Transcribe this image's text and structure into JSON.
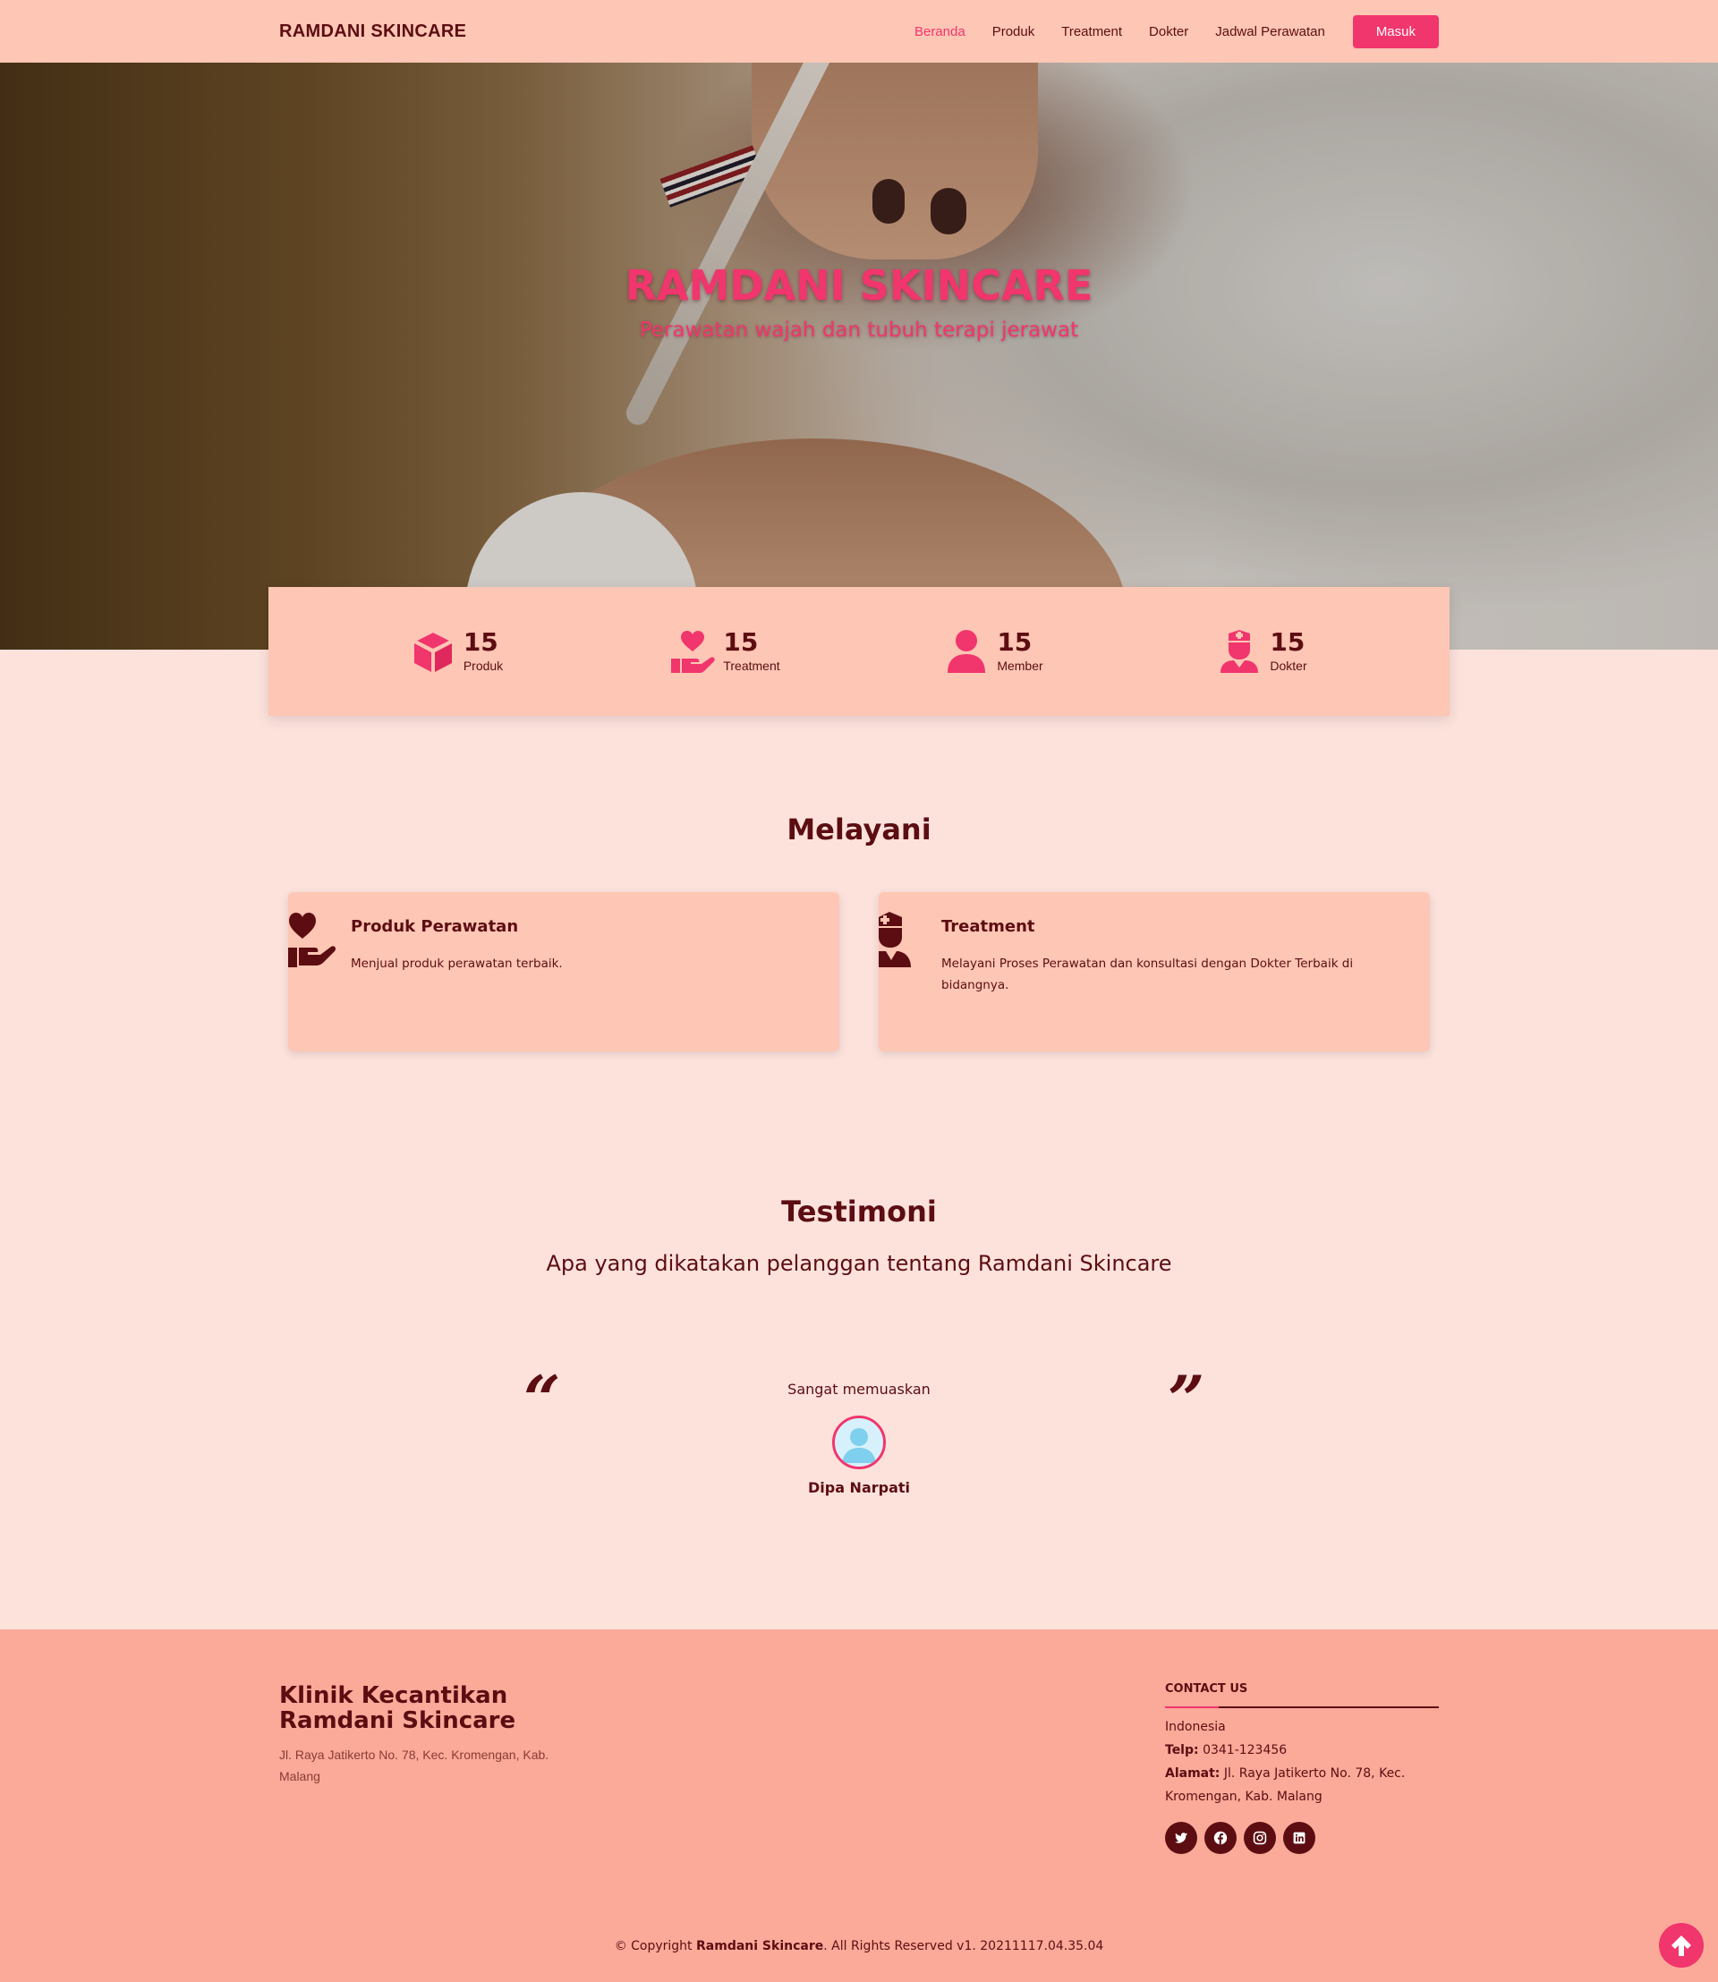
{
  "navbar": {
    "brand": "RAMDANI SKINCARE",
    "links": [
      {
        "label": "Beranda",
        "active": true
      },
      {
        "label": "Produk",
        "active": false
      },
      {
        "label": "Treatment",
        "active": false
      },
      {
        "label": "Dokter",
        "active": false
      },
      {
        "label": "Jadwal Perawatan",
        "active": false
      }
    ],
    "login_label": "Masuk"
  },
  "hero": {
    "title": "RAMDANI SKINCARE",
    "subtitle": "Perawatan wajah dan tubuh terapi jerawat"
  },
  "stats": [
    {
      "icon": "box-icon",
      "count": "15",
      "label": "Produk"
    },
    {
      "icon": "hand-holding-heart-icon",
      "count": "15",
      "label": "Treatment"
    },
    {
      "icon": "user-icon",
      "count": "15",
      "label": "Member"
    },
    {
      "icon": "nurse-icon",
      "count": "15",
      "label": "Dokter"
    }
  ],
  "services": {
    "title": "Melayani",
    "items": [
      {
        "icon": "hand-holding-heart-icon",
        "title": "Produk Perawatan",
        "desc": "Menjual produk perawatan terbaik."
      },
      {
        "icon": "nurse-icon",
        "title": "Treatment",
        "desc": "Melayani Proses Perawatan dan konsultasi dengan Dokter Terbaik di bidangnya."
      }
    ]
  },
  "testimonials": {
    "title": "Testimoni",
    "subtitle": "Apa yang dikatakan pelanggan tentang Ramdani Skincare",
    "open_quote": "“",
    "close_quote": "”",
    "items": [
      {
        "text": "Sangat memuaskan",
        "name": "Dipa Narpati"
      }
    ]
  },
  "footer": {
    "title_line1": "Klinik Kecantikan",
    "title_line2": "Ramdani Skincare",
    "address": "Jl. Raya Jatikerto No. 78, Kec. Kromengan, Kab. Malang",
    "contact_title": "CONTACT US",
    "country": "Indonesia",
    "telp_label": "Telp:",
    "telp_value": "0341-123456",
    "alamat_label": "Alamat:",
    "alamat_value": "Jl. Raya Jatikerto No. 78, Kec. Kromengan, Kab. Malang",
    "socials": [
      "twitter-icon",
      "facebook-icon",
      "instagram-icon",
      "linkedin-icon"
    ],
    "copyright_prefix": "© Copyright",
    "copyright_brand": "Ramdani Skincare",
    "copyright_suffix": ". All Rights Reserved v1. 20211117.04.35.04"
  },
  "colors": {
    "accent": "#f1356d",
    "dark": "#5c0d12",
    "nav_bg": "#fec6b4",
    "page_bg": "#fde2dc",
    "footer_bg": "#fbaa99"
  }
}
